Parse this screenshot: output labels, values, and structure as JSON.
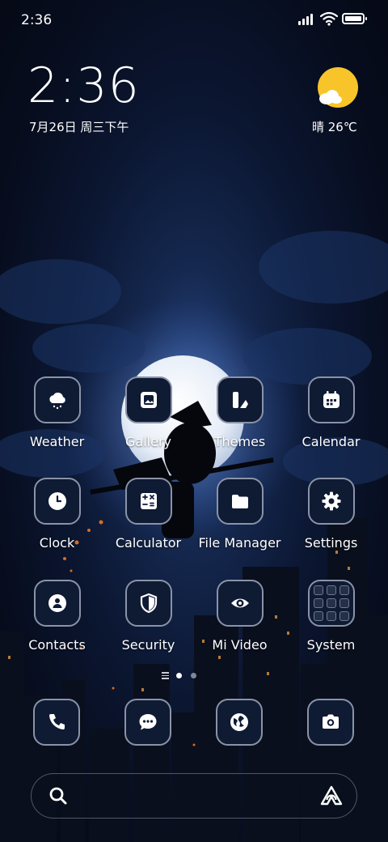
{
  "status_bar": {
    "time": "2:36"
  },
  "clock_widget": {
    "time": "2:36",
    "date": "7月26日 周三下午"
  },
  "weather_widget": {
    "temperature": "晴 26℃",
    "icon": "sun-cloud-icon"
  },
  "apps": [
    {
      "label": "Weather",
      "icon": "weather-icon"
    },
    {
      "label": "Gallery",
      "icon": "gallery-icon"
    },
    {
      "label": "Themes",
      "icon": "themes-icon"
    },
    {
      "label": "Calendar",
      "icon": "calendar-icon"
    },
    {
      "label": "Clock",
      "icon": "clock-icon"
    },
    {
      "label": "Calculator",
      "icon": "calculator-icon"
    },
    {
      "label": "File Manager",
      "icon": "folder-icon"
    },
    {
      "label": "Settings",
      "icon": "gear-icon"
    },
    {
      "label": "Contacts",
      "icon": "contact-icon"
    },
    {
      "label": "Security",
      "icon": "shield-icon"
    },
    {
      "label": "Mi Video",
      "icon": "eye-icon"
    },
    {
      "label": "System",
      "icon": "folder-grid-icon"
    }
  ],
  "page_indicator": {
    "pages": 2,
    "current": 1
  },
  "dock": [
    {
      "icon": "phone-icon"
    },
    {
      "icon": "message-icon"
    },
    {
      "icon": "globe-icon"
    },
    {
      "icon": "camera-icon"
    }
  ],
  "search_bar": {
    "left_icon": "search-icon",
    "right_icon": "assistant-icon"
  },
  "colors": {
    "icon_bg": "#0f1a33",
    "icon_border": "#8a93a8",
    "sun": "#f7c52a"
  }
}
